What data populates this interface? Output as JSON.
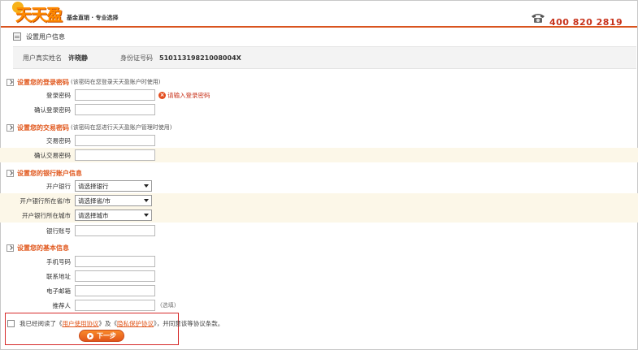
{
  "header": {
    "logo_text": "天天盈",
    "slogan": "基金直销 · 专业选择",
    "phone_icon": "telephone-icon",
    "phone_number": "400 820 2819"
  },
  "page": {
    "title": "设置用户信息"
  },
  "realname": {
    "name_label": "用户真实姓名",
    "name_value": "许晓静",
    "id_label": "身份证号码",
    "id_value": "51011319821008004X"
  },
  "login_password": {
    "title": "设置您的登录密码",
    "note": "(该密码在您登录天天盈账户时使用)",
    "password_label": "登录密码",
    "password_error": "请输入登录密码",
    "confirm_label": "确认登录密码"
  },
  "trade_password": {
    "title": "设置您的交易密码",
    "note": "(该密码在您进行天天盈账户管理时使用)",
    "password_label": "交易密码",
    "confirm_label": "确认交易密码"
  },
  "bank_account": {
    "title": "设置您的银行账户信息",
    "bank_label": "开户银行",
    "bank_select": "请选择银行",
    "province_label": "开户银行所在省/市",
    "province_select": "请选择省/市",
    "city_label": "开户银行所在城市",
    "city_select": "请选择城市",
    "account_label": "银行账号"
  },
  "basic_info": {
    "title": "设置您的基本信息",
    "mobile_label": "手机号码",
    "address_label": "联系地址",
    "email_label": "电子邮箱",
    "referrer_label": "推荐人",
    "referrer_note": "(选填)"
  },
  "agreement": {
    "prefix": "我已经阅读了《",
    "user_agreement": "用户使用协议",
    "middle": "》及《",
    "privacy_agreement": "隐私保护协议",
    "suffix": "》，并同意该等协议条款。",
    "next_label": "下一步"
  },
  "colors": {
    "accent": "#e0561b",
    "error": "#c8331b",
    "alt_row": "#fcf7e8",
    "highlight_border": "#d62a2a"
  }
}
